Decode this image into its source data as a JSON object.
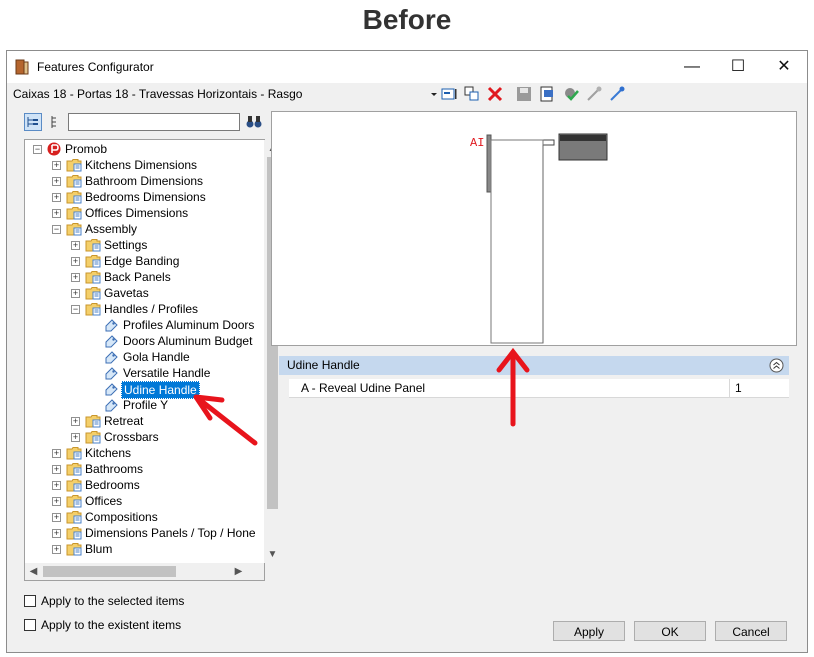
{
  "heading": "Before",
  "window": {
    "title": "Features Configurator",
    "minimize_glyph": "—",
    "maximize_glyph": "☐",
    "close_glyph": "✕"
  },
  "path": "Caixas 18 - Portas 18 - Travessas Horizontais - Rasgo",
  "toolbar": {
    "icons": [
      "dropdown-icon",
      "properties-icon",
      "copy-icon",
      "delete-icon",
      "save-icon",
      "export-icon",
      "settings-check-icon",
      "collapse-icon",
      "expand-icon"
    ]
  },
  "search": {
    "value": "",
    "placeholder": ""
  },
  "tree": {
    "root": "Promob",
    "items": [
      {
        "label": "Kitchens Dimensions",
        "level": 1,
        "type": "folder",
        "exp": "+"
      },
      {
        "label": "Bathroom Dimensions",
        "level": 1,
        "type": "folder",
        "exp": "+"
      },
      {
        "label": "Bedrooms Dimensions",
        "level": 1,
        "type": "folder",
        "exp": "+"
      },
      {
        "label": "Offices Dimensions",
        "level": 1,
        "type": "folder",
        "exp": "+"
      },
      {
        "label": "Assembly",
        "level": 1,
        "type": "folder",
        "exp": "−"
      },
      {
        "label": "Settings",
        "level": 2,
        "type": "folder",
        "exp": "+"
      },
      {
        "label": "Edge Banding",
        "level": 2,
        "type": "folder",
        "exp": "+"
      },
      {
        "label": "Back Panels",
        "level": 2,
        "type": "folder",
        "exp": "+"
      },
      {
        "label": "Gavetas",
        "level": 2,
        "type": "folder",
        "exp": "+"
      },
      {
        "label": "Handles / Profiles",
        "level": 2,
        "type": "folder",
        "exp": "−"
      },
      {
        "label": "Profiles Aluminum Doors",
        "level": 3,
        "type": "leaf",
        "exp": ""
      },
      {
        "label": "Doors Aluminum Budget",
        "level": 3,
        "type": "leaf",
        "exp": ""
      },
      {
        "label": "Gola Handle",
        "level": 3,
        "type": "leaf",
        "exp": ""
      },
      {
        "label": "Versatile Handle",
        "level": 3,
        "type": "leaf",
        "exp": ""
      },
      {
        "label": "Udine Handle",
        "level": 3,
        "type": "leaf",
        "exp": "",
        "selected": true
      },
      {
        "label": "Profile Y",
        "level": 3,
        "type": "leaf",
        "exp": ""
      },
      {
        "label": "Retreat",
        "level": 2,
        "type": "folder",
        "exp": "+"
      },
      {
        "label": "Crossbars",
        "level": 2,
        "type": "folder",
        "exp": "+"
      },
      {
        "label": "Kitchens",
        "level": 1,
        "type": "folder",
        "exp": "+"
      },
      {
        "label": "Bathrooms",
        "level": 1,
        "type": "folder",
        "exp": "+"
      },
      {
        "label": "Bedrooms",
        "level": 1,
        "type": "folder",
        "exp": "+"
      },
      {
        "label": "Offices",
        "level": 1,
        "type": "folder",
        "exp": "+"
      },
      {
        "label": "Compositions",
        "level": 1,
        "type": "folder",
        "exp": "+"
      },
      {
        "label": "Dimensions Panels / Top / Hone",
        "level": 1,
        "type": "folder",
        "exp": "+"
      },
      {
        "label": "Blum",
        "level": 1,
        "type": "folder",
        "exp": "+"
      }
    ]
  },
  "preview": {
    "marker_label": "AI"
  },
  "properties": {
    "group_title": "Udine Handle",
    "rows": [
      {
        "name": "A - Reveal Udine Panel",
        "value": "1"
      }
    ]
  },
  "options": {
    "apply_selected": "Apply to the selected items",
    "apply_existent": "Apply to the existent items"
  },
  "buttons": {
    "apply": "Apply",
    "ok": "OK",
    "cancel": "Cancel"
  },
  "colors": {
    "annotation_red": "#e8141c",
    "selection_blue": "#0078d7"
  }
}
